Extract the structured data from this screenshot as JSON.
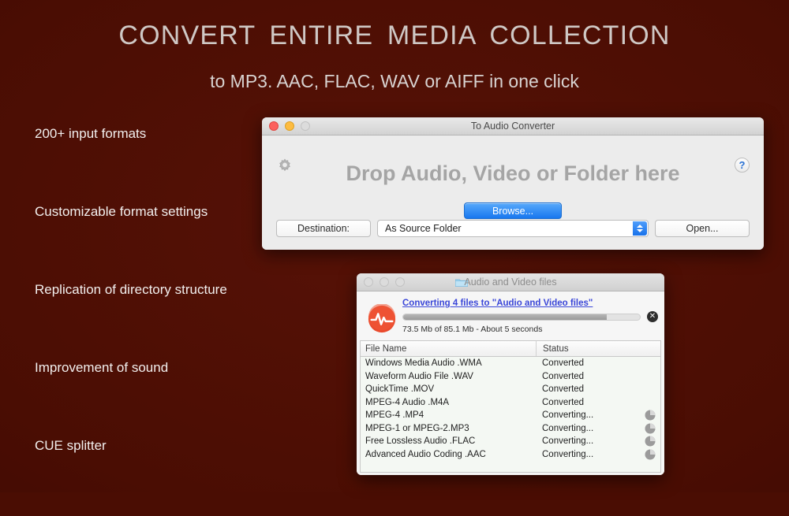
{
  "page": {
    "background_color": "#4a0d03",
    "headline": "CONVERT  ENTIRE  MEDIA  COLLECTION",
    "subheadline": "to MP3. AAC, FLAC, WAV or AIFF in one click"
  },
  "features": [
    {
      "label": "200+ input formats"
    },
    {
      "label": "Customizable format settings"
    },
    {
      "label": "Replication of directory structure"
    },
    {
      "label": "Improvement of sound"
    },
    {
      "label": "CUE splitter"
    }
  ],
  "converter_window": {
    "title": "To Audio Converter",
    "traffic_lights": [
      "close-red",
      "minimize-yellow",
      "zoom-disabled"
    ],
    "gear_icon": "gear-icon",
    "help_icon": "help-question-icon",
    "help_label": "?",
    "drop_text": "Drop Audio, Video or Folder here",
    "browse_label": "Browse...",
    "destination_label": "Destination:",
    "destination_value": "As Source Folder",
    "open_label": "Open...",
    "accent_color": "#1877ef"
  },
  "progress_window": {
    "title": "Audio and Video files",
    "folder_icon": "folder-icon",
    "app_icon": "waveform-app-icon",
    "converting_link": "Converting 4 files to \"Audio and Video files\"",
    "progress_percent": 86,
    "status_text": "73.5 Mb of 85.1 Mb - About 5 seconds",
    "cancel_label": "✕",
    "link_color": "#3a46d8",
    "columns": [
      "File Name",
      "Status"
    ],
    "rows": [
      {
        "name": "Windows Media Audio .WMA",
        "status": "Converted",
        "spinner": false
      },
      {
        "name": "Waveform Audio File .WAV",
        "status": "Converted",
        "spinner": false
      },
      {
        "name": "QuickTime .MOV",
        "status": "Converted",
        "spinner": false
      },
      {
        "name": "MPEG-4 Audio .M4A",
        "status": "Converted",
        "spinner": false
      },
      {
        "name": "MPEG-4 .MP4",
        "status": "Converting...",
        "spinner": true
      },
      {
        "name": "MPEG-1 or MPEG-2.MP3",
        "status": "Converting...",
        "spinner": true
      },
      {
        "name": "Free Lossless Audio .FLAC",
        "status": "Converting...",
        "spinner": true
      },
      {
        "name": "Advanced Audio Coding .AAC",
        "status": "Converting...",
        "spinner": true
      }
    ]
  }
}
